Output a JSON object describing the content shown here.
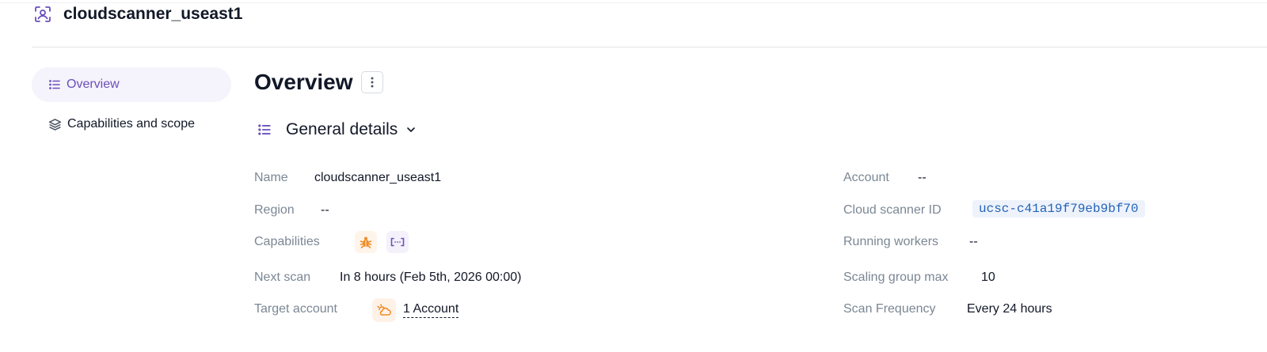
{
  "app": {
    "title": "cloudscanner_useast1",
    "icon": "scanner-icon"
  },
  "sidebar": {
    "items": [
      {
        "label": "Overview",
        "icon": "list-icon",
        "active": true
      },
      {
        "label": "Capabilities and scope",
        "icon": "layers-icon",
        "active": false
      }
    ]
  },
  "main": {
    "title": "Overview",
    "section": {
      "title": "General details"
    },
    "details_left": {
      "name": {
        "label": "Name",
        "value": "cloudscanner_useast1"
      },
      "region": {
        "label": "Region",
        "value": "--"
      },
      "capabilities": {
        "label": "Capabilities",
        "icons": [
          "bug-icon",
          "code-brackets-icon"
        ]
      },
      "next_scan": {
        "label": "Next scan",
        "value": "In 8 hours (Feb 5th, 2026 00:00)"
      },
      "target_account": {
        "label": "Target account",
        "value": "1 Account",
        "icon": "cloud-icon"
      }
    },
    "details_right": {
      "account": {
        "label": "Account",
        "value": "--"
      },
      "scanner_id": {
        "label": "Cloud scanner ID",
        "value": "ucsc-c41a19f79eb9bf70"
      },
      "running_workers": {
        "label": "Running workers",
        "value": "--"
      },
      "scaling_group_max": {
        "label": "Scaling group max",
        "value": "10"
      },
      "scan_frequency": {
        "label": "Scan Frequency",
        "value": "Every 24 hours"
      }
    }
  },
  "colors": {
    "accent": "#6b4fbb",
    "active_bg": "#f5f3fb",
    "label": "#7b8794",
    "id_text": "#2563b8",
    "id_bg": "#eef3fb",
    "orange": "#f08a24"
  }
}
